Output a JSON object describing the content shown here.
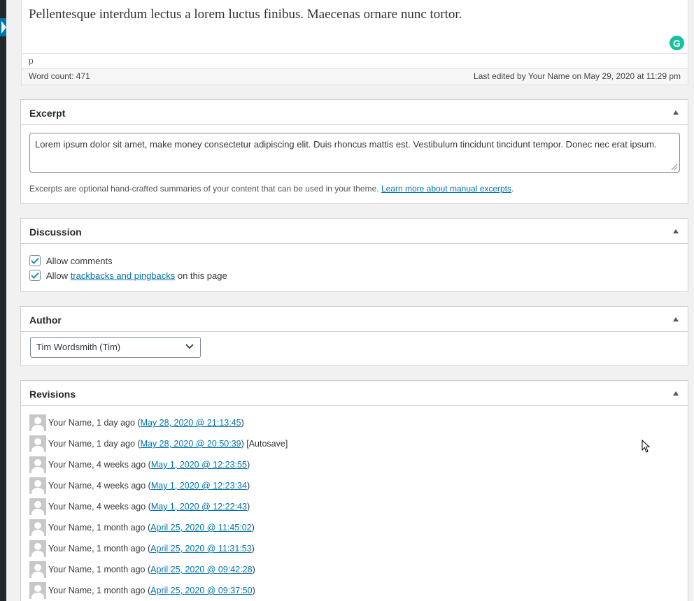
{
  "editor": {
    "content": "Pellentesque interdum lectus a lorem luctus finibus. Maecenas ornare nunc tortor.",
    "path": "p",
    "word_count": "Word count: 471",
    "last_edited": "Last edited by Your Name on May 29, 2020 at 11:29 pm",
    "grammarly_letter": "G"
  },
  "excerpt": {
    "title": "Excerpt",
    "text": "Lorem ipsum dolor sit amet, make money consectetur adipiscing elit. Duis rhoncus mattis est. Vestibulum tincidunt tincidunt tempor. Donec nec erat ipsum.",
    "help_prefix": "Excerpts are optional hand-crafted summaries of your content that can be used in your theme. ",
    "help_link": "Learn more about manual excerpts",
    "help_suffix": "."
  },
  "discussion": {
    "title": "Discussion",
    "allow_comments": "Allow comments",
    "allow_prefix": "Allow ",
    "allow_link": "trackbacks and pingbacks",
    "allow_suffix": " on this page"
  },
  "author": {
    "title": "Author",
    "selected": "Tim Wordsmith (Tim)"
  },
  "revisions": {
    "title": "Revisions",
    "items": [
      {
        "who": "Your Name, 1 day ago (",
        "link": "May 28, 2020 @ 21:13:45",
        "after": ")"
      },
      {
        "who": "Your Name, 1 day ago (",
        "link": "May 28, 2020 @ 20:50:39",
        "after": ") [Autosave]"
      },
      {
        "who": "Your Name, 4 weeks ago (",
        "link": "May 1, 2020 @ 12:23:55",
        "after": ")"
      },
      {
        "who": "Your Name, 4 weeks ago (",
        "link": "May 1, 2020 @ 12:23:34",
        "after": ")"
      },
      {
        "who": "Your Name, 4 weeks ago (",
        "link": "May 1, 2020 @ 12:22:43",
        "after": ")"
      },
      {
        "who": "Your Name, 1 month ago (",
        "link": "April 25, 2020 @ 11:45:02",
        "after": ")"
      },
      {
        "who": "Your Name, 1 month ago (",
        "link": "April 25, 2020 @ 11:31:53",
        "after": ")"
      },
      {
        "who": "Your Name, 1 month ago (",
        "link": "April 25, 2020 @ 09:42:28",
        "after": ")"
      },
      {
        "who": "Your Name, 1 month ago (",
        "link": "April 25, 2020 @ 09:37:50",
        "after": ")"
      }
    ]
  },
  "colors": {
    "accent": "#0073aa",
    "grammarly": "#15c39a",
    "border": "#ccd0d4"
  }
}
